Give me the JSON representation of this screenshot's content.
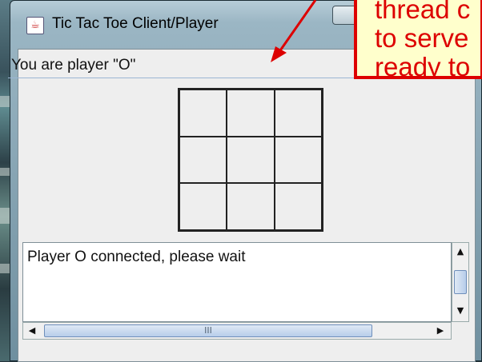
{
  "window": {
    "title": "Tic Tac Toe Client/Player"
  },
  "status": {
    "text": "You are player \"O\""
  },
  "board": {
    "cells": [
      "",
      "",
      "",
      "",
      "",
      "",
      "",
      "",
      ""
    ]
  },
  "log": {
    "text": "Player O connected, please wait"
  },
  "scroll": {
    "h_thumb_grip": "III"
  },
  "annotation": {
    "lines": [
      "thread c",
      "to serve",
      "ready to"
    ],
    "color": "#dd0000"
  }
}
